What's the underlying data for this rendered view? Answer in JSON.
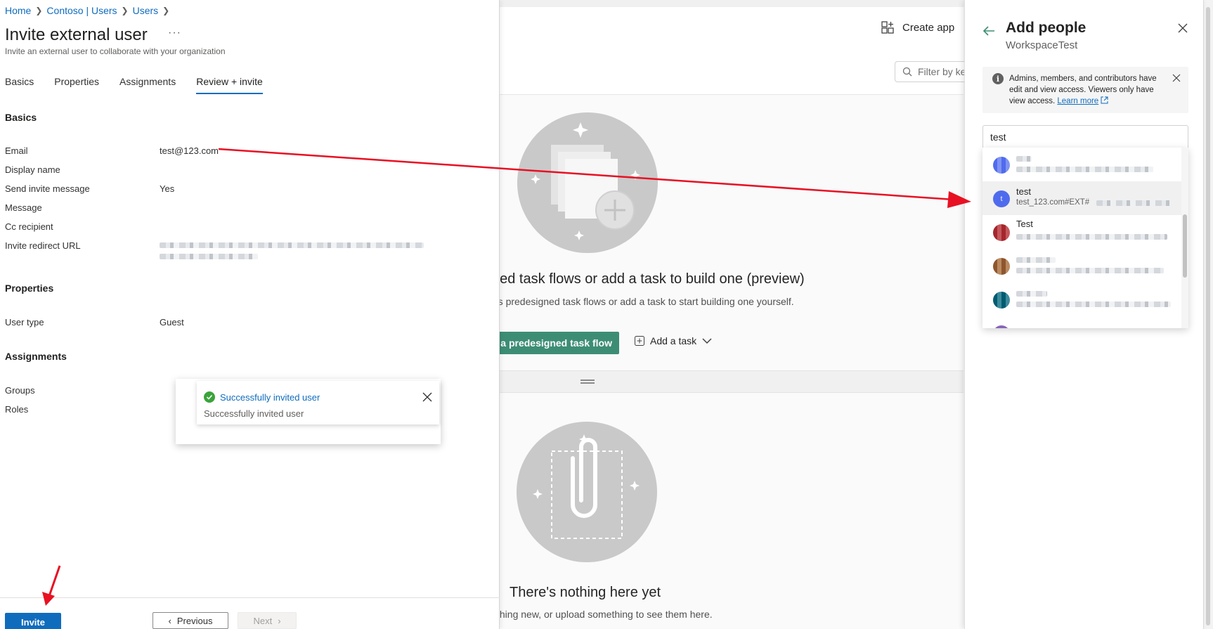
{
  "invite": {
    "breadcrumb": [
      "Home",
      "Contoso | Users",
      "Users"
    ],
    "title": "Invite external user",
    "more": "···",
    "subtitle": "Invite an external user to collaborate with your organization",
    "tabs": [
      "Basics",
      "Properties",
      "Assignments",
      "Review + invite"
    ],
    "active_tab": "Review + invite",
    "sections": {
      "basics": "Basics",
      "properties": "Properties",
      "assignments": "Assignments"
    },
    "fields": {
      "email_label": "Email",
      "email_value": "test@123.com",
      "display_name_label": "Display name",
      "send_invite_label": "Send invite message",
      "send_invite_value": "Yes",
      "message_label": "Message",
      "cc_label": "Cc recipient",
      "redirect_label": "Invite redirect URL",
      "user_type_label": "User type",
      "user_type_value": "Guest",
      "groups_label": "Groups",
      "roles_label": "Roles"
    },
    "buttons": {
      "invite": "Invite",
      "previous": "Previous",
      "next": "Next"
    },
    "toast": {
      "title": "Successfully invited user",
      "body": "Successfully invited user"
    }
  },
  "workspace": {
    "create_app": "Create app",
    "filter_placeholder": "Filter by ke",
    "task_title": "ned task flows or add a task to build one (preview)",
    "task_sub": "'s predesigned task flows or add a task to start building one yourself.",
    "predesigned_button": "t a predesigned task flow",
    "add_task": "Add a task",
    "files_title": "There's nothing here yet",
    "files_sub": "thing new, or upload something to see them here."
  },
  "add_people": {
    "title": "Add people",
    "workspace": "WorkspaceTest",
    "info": "Admins, members, and contributors have edit and view access. Viewers only have view access.",
    "learn_more": "Learn more",
    "search_value": "test",
    "results": [
      {
        "name": "",
        "email": "",
        "avatar_color": "#4f6bed",
        "blurred": true
      },
      {
        "name": "test",
        "email": "test_123.com#EXT#",
        "avatar_letter": "t",
        "avatar_color": "#4f6bed",
        "selected": true
      },
      {
        "name": "Test",
        "email": "",
        "avatar_color": "#a4262c",
        "blurred": true
      },
      {
        "name": "",
        "email": "",
        "avatar_color": "#8e562e",
        "blurred": true
      },
      {
        "name": "",
        "email": "",
        "avatar_color": "#005b70",
        "blurred": true
      }
    ]
  },
  "colors": {
    "accent": "#0f6cbd",
    "fabric_green": "#3d8d74",
    "success": "#3aa43a",
    "annotation_red": "#e81123"
  }
}
